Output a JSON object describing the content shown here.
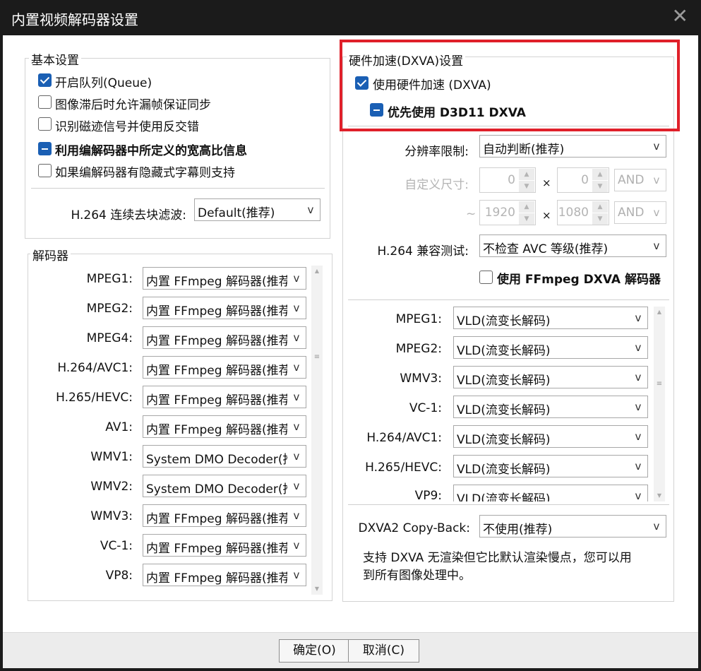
{
  "window": {
    "title": "内置视频解码器设置",
    "close_glyph": "✕"
  },
  "basic": {
    "title": "基本设置",
    "options": [
      {
        "label": "开启队列(Queue)",
        "state": "checked"
      },
      {
        "label": "图像滞后时允许漏帧保证同步",
        "state": "unchecked"
      },
      {
        "label": "识别磁迹信号并使用反交错",
        "state": "unchecked"
      },
      {
        "label": "利用编解码器中所定义的宽高比信息",
        "state": "indeterminate"
      },
      {
        "label": "如果编解码器有隐藏式字幕则支持",
        "state": "unchecked"
      }
    ],
    "deblock_label": "H.264 连续去块滤波:",
    "deblock_value": "Default(推荐)"
  },
  "decoders": {
    "title": "解码器",
    "rows": [
      {
        "label": "MPEG1:",
        "value": "内置 FFmpeg 解码器(推荐)"
      },
      {
        "label": "MPEG2:",
        "value": "内置 FFmpeg 解码器(推荐)"
      },
      {
        "label": "MPEG4:",
        "value": "内置 FFmpeg 解码器(推荐)"
      },
      {
        "label": "H.264/AVC1:",
        "value": "内置 FFmpeg 解码器(推荐)"
      },
      {
        "label": "H.265/HEVC:",
        "value": "内置 FFmpeg 解码器(推荐)"
      },
      {
        "label": "AV1:",
        "value": "内置 FFmpeg 解码器(推荐)"
      },
      {
        "label": "WMV1:",
        "value": "System DMO Decoder(推荐)"
      },
      {
        "label": "WMV2:",
        "value": "System DMO Decoder(推荐)"
      },
      {
        "label": "WMV3:",
        "value": "内置 FFmpeg 解码器(推荐)"
      },
      {
        "label": "VC-1:",
        "value": "内置 FFmpeg 解码器(推荐)"
      },
      {
        "label": "VP8:",
        "value": "内置 FFmpeg 解码器(推荐)"
      }
    ]
  },
  "hw": {
    "title": "硬件加速(DXVA)设置",
    "use_hw": {
      "label": "使用硬件加速 (DXVA)",
      "state": "checked"
    },
    "prefer_d3d11": {
      "label": "优先使用 D3D11 DXVA",
      "state": "indeterminate"
    },
    "resolution_label": "分辨率限制:",
    "resolution_value": "自动判断(推荐)",
    "custom_size_label": "自定义尺寸:",
    "min_w": "0",
    "min_h": "0",
    "min_logic": "AND",
    "tilde": "~",
    "max_w": "1920",
    "max_h": "1080",
    "max_logic": "AND",
    "times": "×",
    "compat_label": "H.264 兼容测试:",
    "compat_value": "不检查 AVC 等级(推荐)",
    "ffmpeg_dxva": {
      "label": "使用 FFmpeg DXVA 解码器",
      "state": "unchecked"
    },
    "modes": [
      {
        "label": "MPEG1:",
        "value": "VLD(流变长解码)"
      },
      {
        "label": "MPEG2:",
        "value": "VLD(流变长解码)"
      },
      {
        "label": "WMV3:",
        "value": "VLD(流变长解码)"
      },
      {
        "label": "VC-1:",
        "value": "VLD(流变长解码)"
      },
      {
        "label": "H.264/AVC1:",
        "value": "VLD(流变长解码)"
      },
      {
        "label": "H.265/HEVC:",
        "value": "VLD(流变长解码)"
      },
      {
        "label": "VP9:",
        "value": "VLD(流变长解码)"
      }
    ],
    "copyback_label": "DXVA2 Copy-Back:",
    "copyback_value": "不使用(推荐)",
    "note_line1": "支持 DXVA 无渲染但它比默认渲染慢点，您可以用",
    "note_line2": "到所有图像处理中。"
  },
  "buttons": {
    "ok": "确定(O)",
    "cancel": "取消(C)"
  },
  "icons": {
    "dropdown": "v",
    "scroll_up": "▲",
    "scroll_down": "▼",
    "grip": "≡"
  }
}
